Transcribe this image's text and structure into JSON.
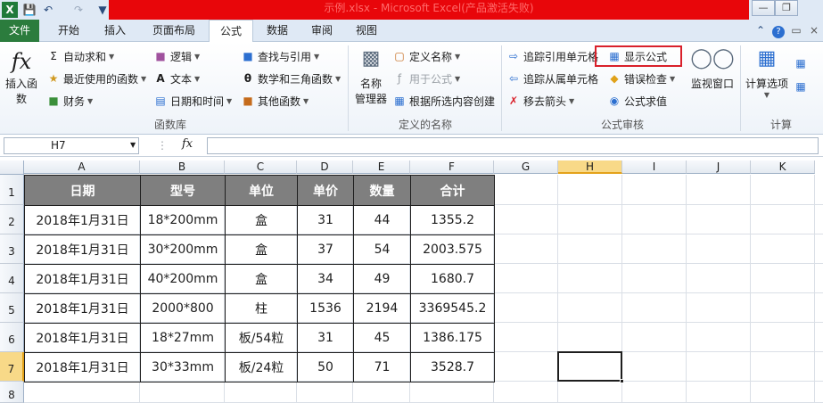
{
  "window": {
    "title": "示例.xlsx - Microsoft Excel(产品激活失败)",
    "app_icon": "excel-x-icon"
  },
  "tabs": [
    "文件",
    "开始",
    "插入",
    "页面布局",
    "公式",
    "数据",
    "审阅",
    "视图"
  ],
  "active_tab": "公式",
  "ribbon": {
    "insert_function": "插入函数",
    "autosum": "自动求和",
    "recent": "最近使用的函数",
    "financial": "财务",
    "logical": "逻辑",
    "text": "文本",
    "datetime": "日期和时间",
    "lookup": "查找与引用",
    "math": "数学和三角函数",
    "more": "其他函数",
    "group_library": "函数库",
    "name_manager_1": "名称",
    "name_manager_2": "管理器",
    "define_name": "定义名称",
    "use_in_formula": "用于公式",
    "create_from_selection": "根据所选内容创建",
    "group_names": "定义的名称",
    "trace_precedents": "追踪引用单元格",
    "trace_dependents": "追踪从属单元格",
    "remove_arrows": "移去箭头",
    "show_formulas": "显示公式",
    "error_checking": "错误检查",
    "evaluate_formula": "公式求值",
    "group_audit": "公式审核",
    "watch_window": "监视窗口",
    "calc_options": "计算选项",
    "group_calc": "计算"
  },
  "formula_bar": {
    "name_box": "H7",
    "fx": "fx",
    "content": ""
  },
  "columns": [
    "A",
    "B",
    "C",
    "D",
    "E",
    "F",
    "G",
    "H",
    "I",
    "J",
    "K"
  ],
  "rows": [
    "1",
    "2",
    "3",
    "4",
    "5",
    "6",
    "7",
    "8"
  ],
  "selected_cell": "H7",
  "table": {
    "headers": [
      "日期",
      "型号",
      "单位",
      "单价",
      "数量",
      "合计"
    ],
    "rows": [
      [
        "2018年1月31日",
        "18*200mm",
        "盒",
        "31",
        "44",
        "1355.2"
      ],
      [
        "2018年1月31日",
        "30*200mm",
        "盒",
        "37",
        "54",
        "2003.575"
      ],
      [
        "2018年1月31日",
        "40*200mm",
        "盒",
        "34",
        "49",
        "1680.7"
      ],
      [
        "2018年1月31日",
        "2000*800",
        "柱",
        "1536",
        "2194",
        "3369545.2"
      ],
      [
        "2018年1月31日",
        "18*27mm",
        "板/54粒",
        "31",
        "45",
        "1386.175"
      ],
      [
        "2018年1月31日",
        "30*33mm",
        "板/24粒",
        "50",
        "71",
        "3528.7"
      ]
    ]
  },
  "colors": {
    "file_tab": "#2b7c3d",
    "title_bar": "#e8060a",
    "header_fill": "#7f7f7f",
    "highlight_box": "#d9202a",
    "selection_hdr": "#f8d988"
  }
}
